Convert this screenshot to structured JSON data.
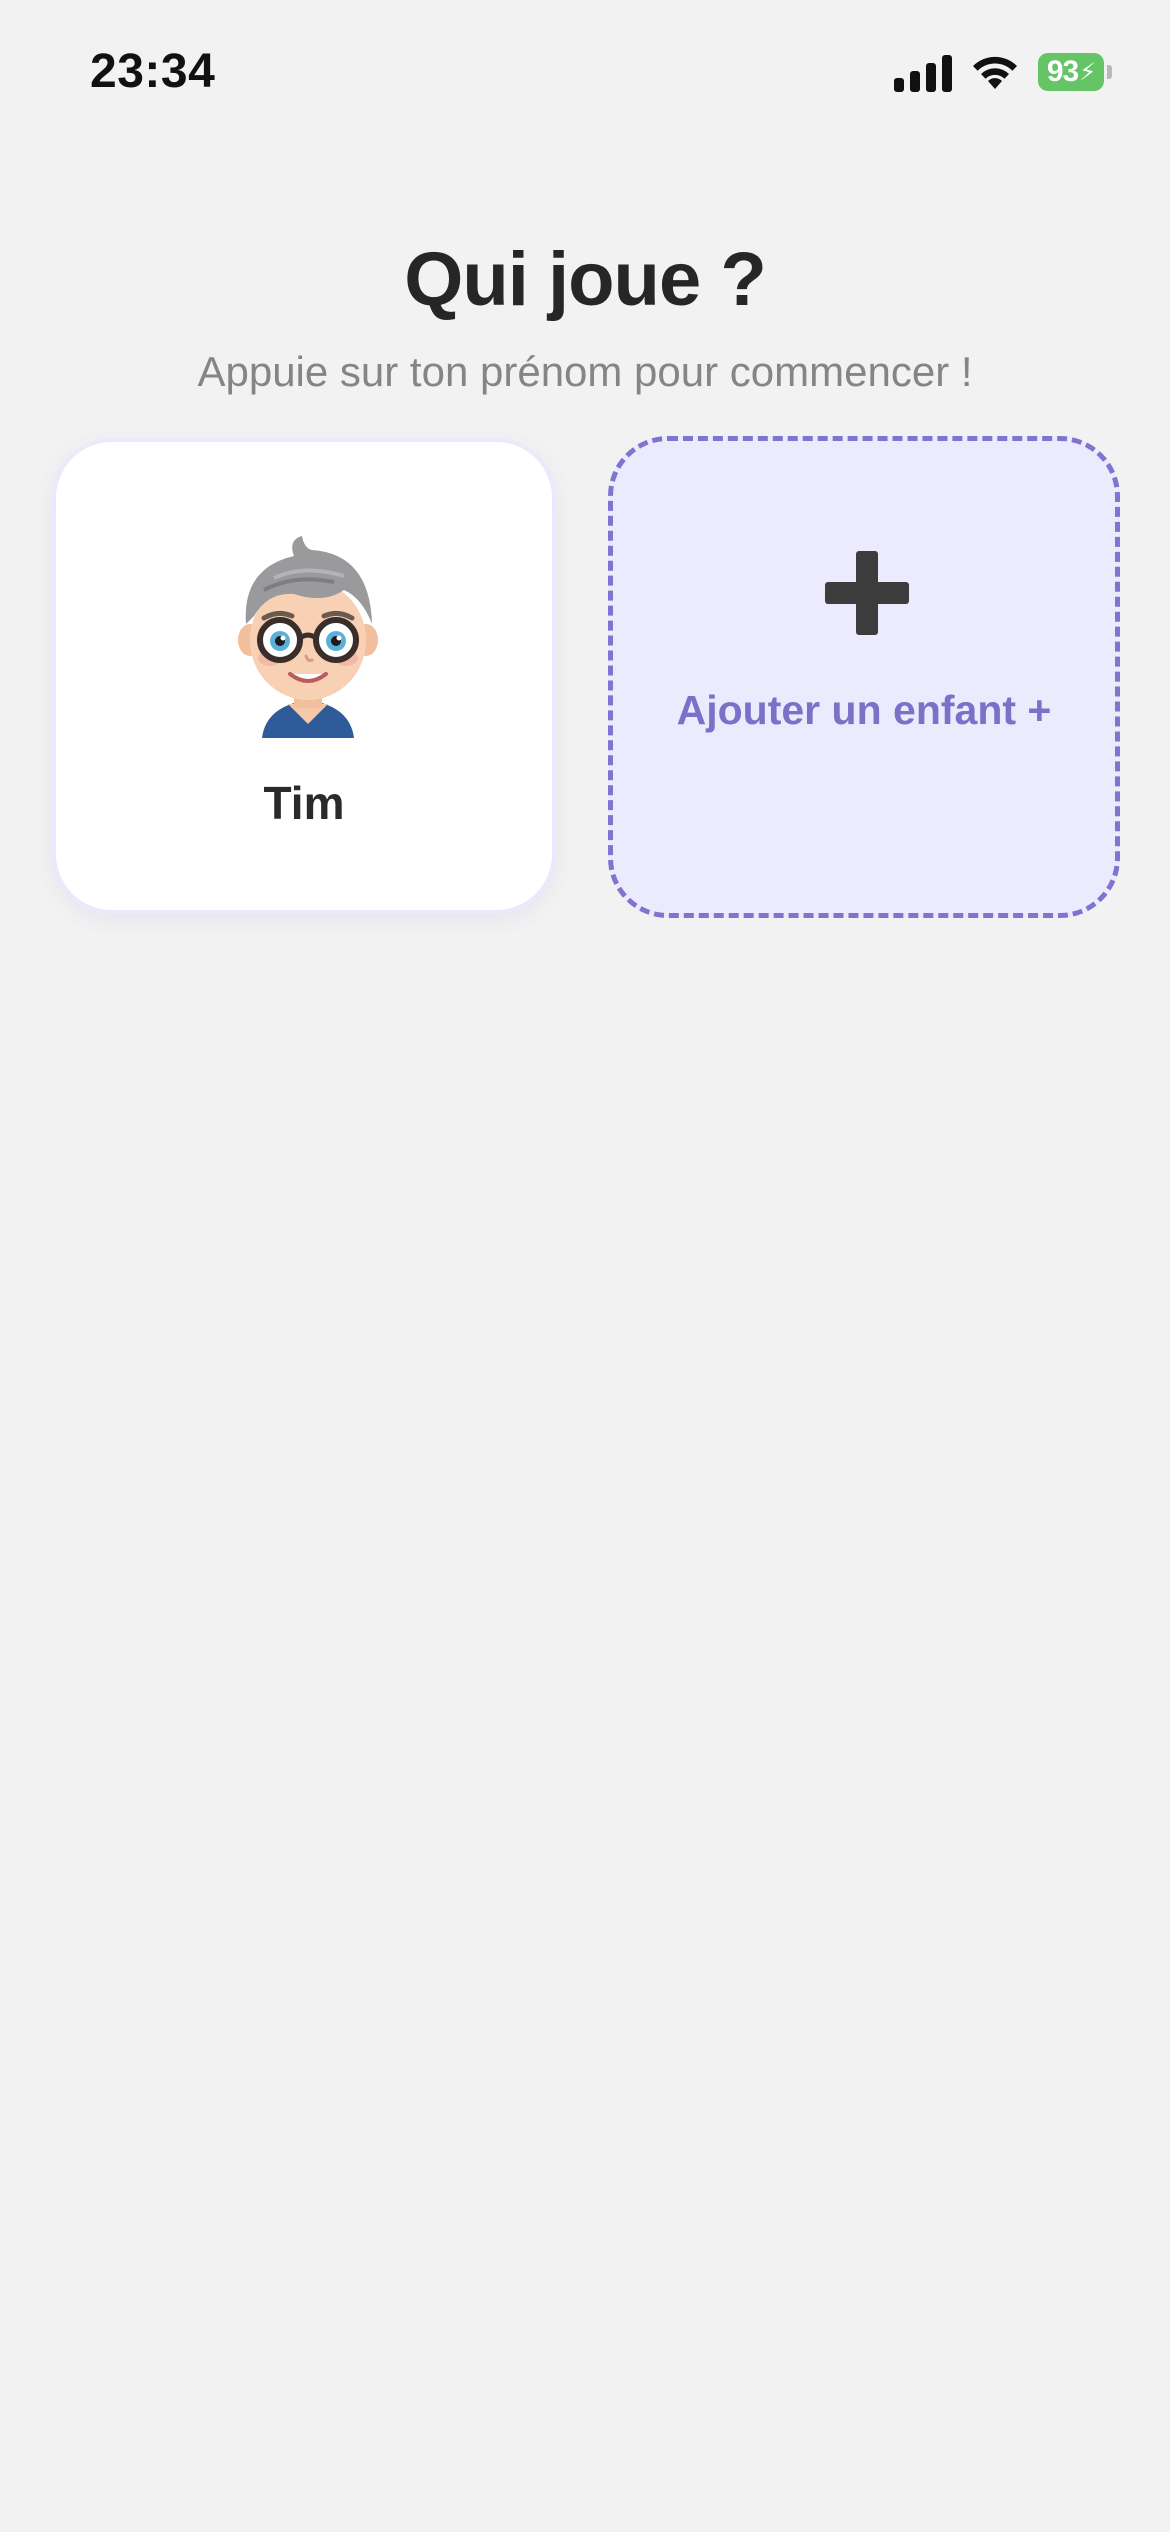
{
  "status_bar": {
    "time": "23:34",
    "battery_level": "93",
    "icons": [
      "signal-icon",
      "wifi-icon",
      "battery-icon"
    ]
  },
  "header": {
    "title": "Qui joue ?",
    "subtitle": "Appuie sur ton prénom pour commencer !"
  },
  "profiles": [
    {
      "name": "Tim",
      "avatar": "boy-with-glasses-avatar"
    }
  ],
  "add_child": {
    "label": "Ajouter un enfant +",
    "icon": "plus-icon"
  },
  "colors": {
    "background": "#f2f2f3",
    "accent": "#7c70c8",
    "add_card_fill": "#ecebfd",
    "battery": "#65c466"
  }
}
